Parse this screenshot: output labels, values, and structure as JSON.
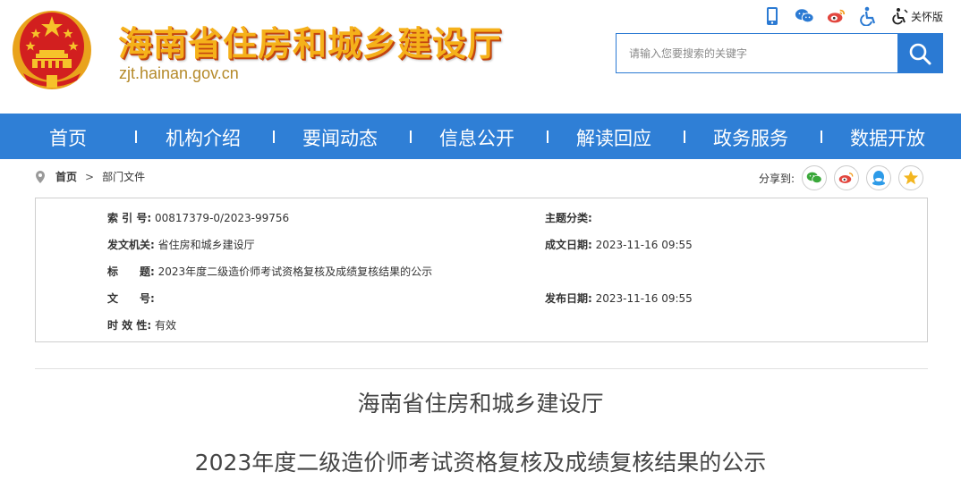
{
  "header": {
    "site_title": "海南省住房和城乡建设厅",
    "site_url": "zjt.hainan.gov.cn",
    "care_label": "关怀版",
    "search_placeholder": "请输入您要搜索的关键字"
  },
  "icons": {
    "mobile": "mobile-icon",
    "wechat": "wechat-icon",
    "weibo": "weibo-icon",
    "accessibility": "accessibility-icon",
    "care": "care-mode-icon",
    "search": "search-icon"
  },
  "colors": {
    "nav_bg": "#2f7fd6",
    "title_gold": "#f5b11a",
    "title_shadow": "#c3440f",
    "wechat_green": "#3aa83a",
    "weibo_red": "#e2463e",
    "qq_blue": "#2d9be8",
    "qzone_yellow": "#f3b620"
  },
  "nav": [
    "首页",
    "机构介绍",
    "要闻动态",
    "信息公开",
    "解读回应",
    "政务服务",
    "数据开放"
  ],
  "breadcrumb": {
    "home": "首页",
    "sep": ">",
    "current": "部门文件"
  },
  "share_label": "分享到:",
  "meta": {
    "index_key": "索 引 号:",
    "index_val": "00817379-0/2023-99756",
    "topic_key": "主题分类:",
    "topic_val": "",
    "issuer_key": "发文机关:",
    "issuer_val": "省住房和城乡建设厅",
    "date_key": "成文日期:",
    "date_val": "2023-11-16 09:55",
    "title_key": "标　　题:",
    "title_val": "2023年度二级造价师考试资格复核及成绩复核结果的公示",
    "docno_key": "文　　号:",
    "docno_val": "",
    "pub_key": "发布日期:",
    "pub_val": "2023-11-16 09:55",
    "valid_key": "时 效 性:",
    "valid_val": "有效"
  },
  "document": {
    "org": "海南省住房和城乡建设厅",
    "title": "2023年度二级造价师考试资格复核及成绩复核结果的公示"
  }
}
